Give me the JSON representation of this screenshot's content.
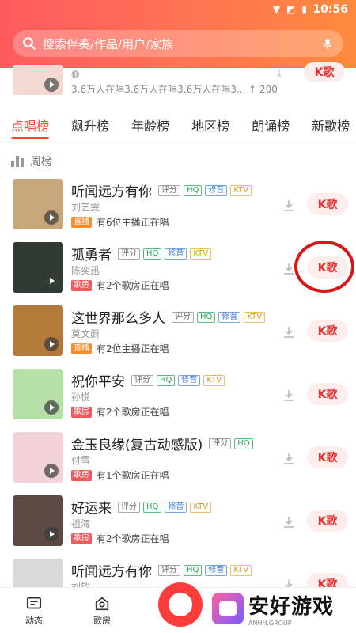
{
  "status": {
    "time": "10:56"
  },
  "search": {
    "placeholder": "搜索伴奏/作品/用户/家族"
  },
  "top_card": {
    "info": "3.6万人在唱3.6万人在唱3.6万人在唱3...",
    "count": "↑ 200",
    "k_label": "K歌"
  },
  "tabs": [
    {
      "label": "点唱榜",
      "active": true
    },
    {
      "label": "飙升榜"
    },
    {
      "label": "年龄榜"
    },
    {
      "label": "地区榜"
    },
    {
      "label": "朗诵榜"
    },
    {
      "label": "新歌榜"
    }
  ],
  "filter": {
    "label": "周榜"
  },
  "songs": [
    {
      "title": "听闻远方有你",
      "artist": "刘艺雯",
      "status_badge": "直播",
      "status": "有6位主播正在唱",
      "tags": [
        "评分",
        "HQ",
        "修音",
        "KTV"
      ],
      "k_label": "K歌",
      "cover_color": "#c7a77a"
    },
    {
      "title": "孤勇者",
      "artist": "陈奕迅",
      "status_badge": "歌房",
      "status": "有2个歌房正在唱",
      "tags": [
        "评分",
        "HQ",
        "修音",
        "KTV"
      ],
      "k_label": "K歌",
      "cover_color": "#2f3a33"
    },
    {
      "title": "这世界那么多人",
      "artist": "莫文蔚",
      "status_badge": "直播",
      "status": "有2位主播正在唱",
      "tags": [
        "评分",
        "HQ",
        "修音",
        "KTV"
      ],
      "k_label": "K歌",
      "cover_color": "#b47a3a"
    },
    {
      "title": "祝你平安",
      "artist": "孙悦",
      "status_badge": "歌房",
      "status": "有2个歌房正在唱",
      "tags": [
        "评分",
        "HQ",
        "修音",
        "KTV"
      ],
      "k_label": "K歌",
      "cover_color": "#b6e0a8"
    },
    {
      "title": "金玉良缘(复古动感版)",
      "artist": "付雪",
      "status_badge": "歌房",
      "status": "有1个歌房正在唱",
      "tags": [
        "评分",
        "HQ"
      ],
      "k_label": "K歌",
      "cover_color": "#f3d3d8"
    },
    {
      "title": "好运来",
      "artist": "祖海",
      "status_badge": "歌房",
      "status": "有2个歌房正在唱",
      "tags": [
        "评分",
        "HQ",
        "修音",
        "KTV"
      ],
      "k_label": "K歌",
      "cover_color": "#5b4a44"
    },
    {
      "title": "听闻远方有你",
      "artist": "刘钧",
      "status_badge": "",
      "status": "",
      "tags": [
        "评分",
        "HQ",
        "修音",
        "KTV"
      ],
      "k_label": "K歌",
      "cover_color": "#d9d9d9"
    }
  ],
  "bottom_nav": {
    "dynamic": "动态",
    "room": "歌房"
  },
  "watermark": {
    "cn": "安好游戏",
    "en": "ANHH.GROUP"
  },
  "colors": {
    "accent": "#ff4b3e",
    "header_start": "#ff5a5f",
    "header_end": "#ff8a3d",
    "k_btn_bg": "#fdeeee"
  }
}
